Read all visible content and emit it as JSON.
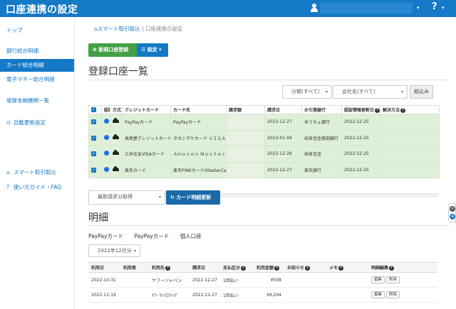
{
  "header": {
    "title": "口座連携の設定",
    "help_label": "?",
    "caret": "▾",
    "user_icon": "user-icon"
  },
  "colors": {
    "brand": "#1479c6",
    "register_button": "#43a047",
    "row_highlight": "#dff0d8"
  },
  "sidebar": {
    "items": [
      {
        "label": "トップ",
        "icon": ""
      },
      {
        "label": "銀行総合明細",
        "icon": ""
      },
      {
        "label": "カード総合明細",
        "icon": "",
        "active": true
      },
      {
        "label": "電子マネー総合明細",
        "icon": ""
      },
      {
        "label": "登録金融機関一覧",
        "icon": ""
      },
      {
        "label": "自動更新設定",
        "icon": "⊙"
      },
      {
        "label": "スマート取引取込",
        "icon": "⌂"
      },
      {
        "label": "使い方ガイド・FAQ",
        "icon": "?"
      }
    ]
  },
  "breadcrumb": {
    "home": "スマート取引取込",
    "separator": "|",
    "current": "口座連携の設定"
  },
  "toolbar": {
    "register_label": "新規口座登録",
    "settings_label": "設定"
  },
  "accounts_section": {
    "title": "登録口座一覧",
    "filter_category": "分類(すべて)",
    "filter_company": "会社名(すべて)",
    "filter_button": "絞込み",
    "columns": [
      "認証",
      "方式",
      "クレジットカード",
      "カード名",
      "請求額",
      "請求日",
      "お引落銀行",
      "認証情報更新日",
      "解決方法"
    ],
    "rows": [
      {
        "company": "PayPayカード",
        "card_name": "PayPayカード",
        "amount": "",
        "billing_date": "2022-12-27",
        "bank": "ゆうちょ銀行",
        "auth_updated": "2022-12-25",
        "resolution": ""
      },
      {
        "company": "高島屋クレジットカード",
        "card_name": "タカシマヤカード ＶＩＳＡ",
        "amount": "",
        "billing_date": "2023-01-04",
        "bank": "岐阜信金美田銀行",
        "auth_updated": "2022-12-25",
        "resolution": ""
      },
      {
        "company": "三井住友VISAカード",
        "card_name": "Ａｍａｚｏｎ Ｍａｓｔｅｒクラシック",
        "amount": "",
        "billing_date": "2022-12-26",
        "bank": "岐阜信金",
        "auth_updated": "2022-12-25",
        "resolution": ""
      },
      {
        "company": "楽天カード",
        "card_name": "楽天PINKカード(MasterCard)",
        "amount": "",
        "billing_date": "2022-12-27",
        "bank": "楽天銀行",
        "auth_updated": "2022-12-25",
        "resolution": ""
      }
    ],
    "status_icon": "cloud-icon",
    "update_select": "最新請求分取得",
    "update_button": "カード明細更新"
  },
  "details_section": {
    "title": "明細",
    "card_tabs": [
      "PayPayカード",
      "PayPayカード",
      "個人口座"
    ],
    "month_select": "2022年12月分",
    "columns": [
      "利用日",
      "利用者",
      "利用先",
      "請求日",
      "支払区分",
      "利用金額",
      "お知らせ",
      "メモ",
      "明細編集"
    ],
    "rows": [
      {
        "date": "2022-10-31",
        "user": "",
        "merchant": "ヤフージャパン",
        "billing_date": "2022-12-27",
        "payment_type": "1回払い",
        "amount": "¥508",
        "notice": "",
        "memo": "",
        "edit": "編集",
        "delete": "削除"
      },
      {
        "date": "2022-11-19",
        "user": "",
        "merchant": "ﾔﾌｰ ｻｯﾂｴｸﾘｯｸﾞ",
        "billing_date": "2022-12-27",
        "payment_type": "1回払い",
        "amount": "¥9,204",
        "notice": "",
        "memo": "",
        "edit": "編集",
        "delete": "削除"
      }
    ]
  },
  "side_widget": {
    "close": "×",
    "chat": "≡"
  }
}
